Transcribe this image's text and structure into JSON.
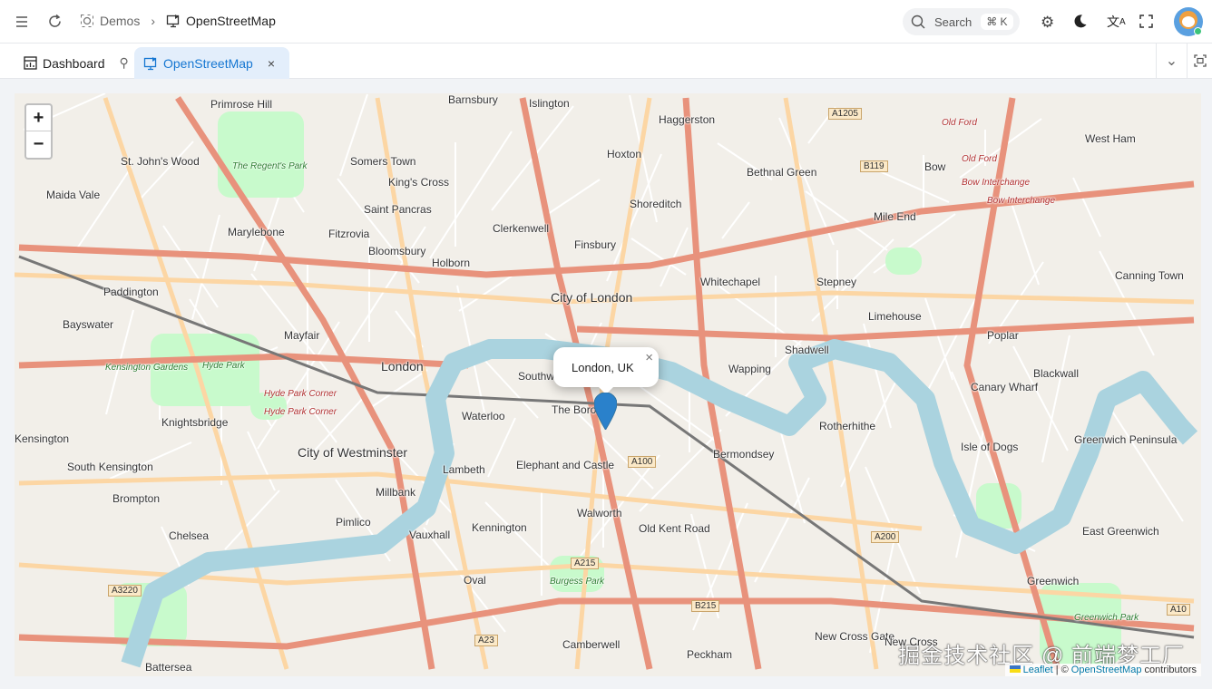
{
  "header": {
    "breadcrumb": [
      "Demos",
      "OpenStreetMap"
    ],
    "search_label": "Search",
    "search_shortcut": "⌘ K"
  },
  "tabs": [
    {
      "label": "Dashboard",
      "pinned": true
    },
    {
      "label": "OpenStreetMap",
      "active": true
    }
  ],
  "map": {
    "zoom_in": "+",
    "zoom_out": "−",
    "popup_text": "London, UK",
    "popup_close": "×",
    "attribution": {
      "leaflet": "Leaflet",
      "separator": "|",
      "copyright": "©",
      "osm": "OpenStreetMap",
      "suffix": "contributors"
    },
    "watermark": "掘金技术社区 @ 前端梦工厂",
    "labels": [
      "Barnsbury",
      "Islington",
      "Haggerston",
      "Primrose Hill",
      "St. John's Wood",
      "Somers Town",
      "Hoxton",
      "Bethnal Green",
      "Bow",
      "West Ham",
      "Maida Vale",
      "King's Cross",
      "Shoreditch",
      "Saint Pancras",
      "Clerkenwell",
      "Mile End",
      "Marylebone",
      "Fitzrovia",
      "Bloomsbury",
      "Finsbury",
      "Holborn",
      "Paddington",
      "Whitechapel",
      "Stepney",
      "Canning Town",
      "City of London",
      "Limehouse",
      "Bayswater",
      "Mayfair",
      "Shadwell",
      "Poplar",
      "London",
      "Wapping",
      "Blackwall",
      "Southwark",
      "Canary Wharf",
      "Knightsbridge",
      "Waterloo",
      "The Borough",
      "Rotherhithe",
      "Kensington",
      "City of Westminster",
      "Bermondsey",
      "Isle of Dogs",
      "Greenwich Peninsula",
      "South Kensington",
      "Lambeth",
      "Elephant and Castle",
      "Brompton",
      "Millbank",
      "Walworth",
      "Pimlico",
      "Kennington",
      "Old Kent Road",
      "East Greenwich",
      "Chelsea",
      "Vauxhall",
      "Oval",
      "Greenwich",
      "Camberwell",
      "Peckham",
      "New Cross Gate",
      "New Cross",
      "Battersea"
    ],
    "parks": [
      "The Regent's Park",
      "Kensington Gardens",
      "Hyde Park",
      "Burgess Park",
      "Greenwich Park"
    ],
    "road_labels": [
      "A1205",
      "B119",
      "A100",
      "A200",
      "A215",
      "B215",
      "A3220",
      "A23",
      "A10"
    ],
    "red_labels": [
      "Hyde Park Corner",
      "Hyde Park Corner",
      "Old Ford",
      "Old Ford",
      "Bow Interchange",
      "Bow Interchange"
    ],
    "colors": {
      "accent": "#1677d2",
      "water": "#aad3df",
      "park": "#c8facc",
      "major_road": "#e8927c",
      "secondary_road": "#fcd6a4",
      "marker": "#2a81cb"
    }
  }
}
